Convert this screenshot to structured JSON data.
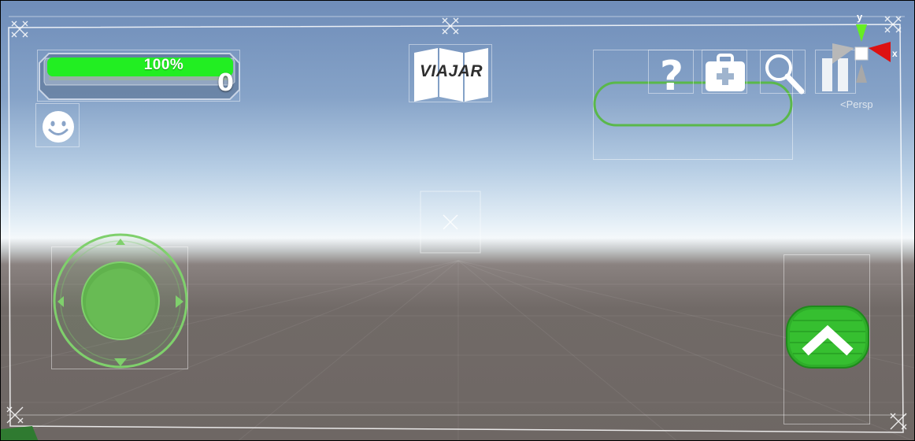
{
  "hud": {
    "health_percent_label": "100%",
    "health_fraction": 1.0,
    "score": "0",
    "map_label": "VIAJAR"
  },
  "icons": {
    "smiley": "smiley-face-icon",
    "help": "question-mark-icon",
    "medkit": "medkit-icon",
    "search": "magnifier-icon",
    "pause": "pause-icon",
    "map": "folded-map-icon",
    "jump": "chevron-up-icon",
    "joystick": "virtual-joystick"
  },
  "scene_gizmo": {
    "y_label": "y",
    "x_label": "x",
    "projection_label": "Persp"
  },
  "colors": {
    "accent_green": "#33cc33",
    "health_green": "#22ee22",
    "gizmo_y": "#66ee22",
    "gizmo_x": "#dd1111"
  }
}
